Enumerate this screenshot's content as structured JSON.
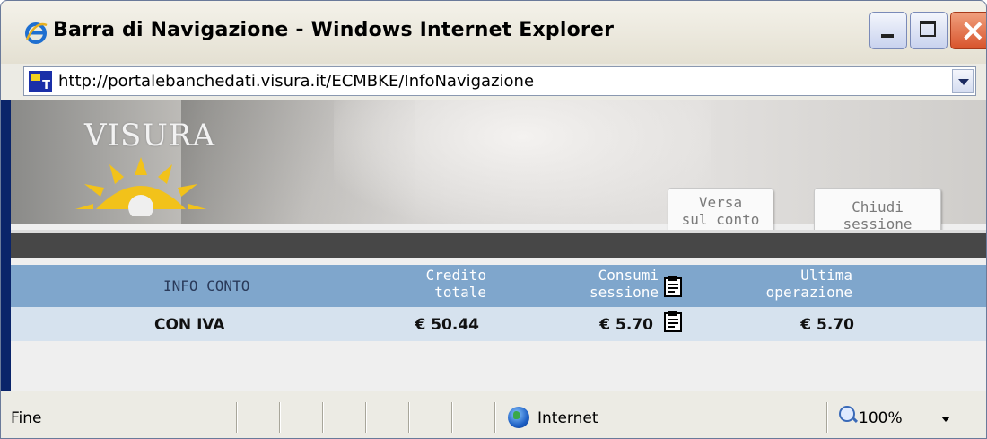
{
  "window": {
    "title": "Barra di Navigazione - Windows Internet Explorer",
    "url": "http://portalebanchedati.visura.it/ECMBKE/InfoNavigazione"
  },
  "banner": {
    "logo_text": "VISURA",
    "buttons": {
      "versa": [
        "Versa",
        "sul conto"
      ],
      "chiudi": [
        "Chiudi",
        "sessione"
      ]
    }
  },
  "table": {
    "headers": {
      "info": "INFO CONTO",
      "credito": [
        "Credito",
        "totale"
      ],
      "consumi": [
        "Consumi",
        "sessione"
      ],
      "ultima": [
        "Ultima",
        "operazione"
      ]
    },
    "row": {
      "label": "CON IVA",
      "credito": "€ 50.44",
      "consumi": "€ 5.70",
      "ultima": "€ 5.70"
    }
  },
  "statusbar": {
    "text": "Fine",
    "zone": "Internet",
    "zoom": "100%"
  },
  "colors": {
    "header_bg": "#7fa6cc",
    "row_bg": "#d6e2ee",
    "logo_sun": "#f2c21a",
    "strip": "#474747"
  },
  "icons": [
    "ie-icon",
    "minimize-icon",
    "maximize-icon",
    "close-icon",
    "site-icon",
    "dropdown-icon",
    "clipboard-icon",
    "globe-icon",
    "zoom-icon"
  ]
}
